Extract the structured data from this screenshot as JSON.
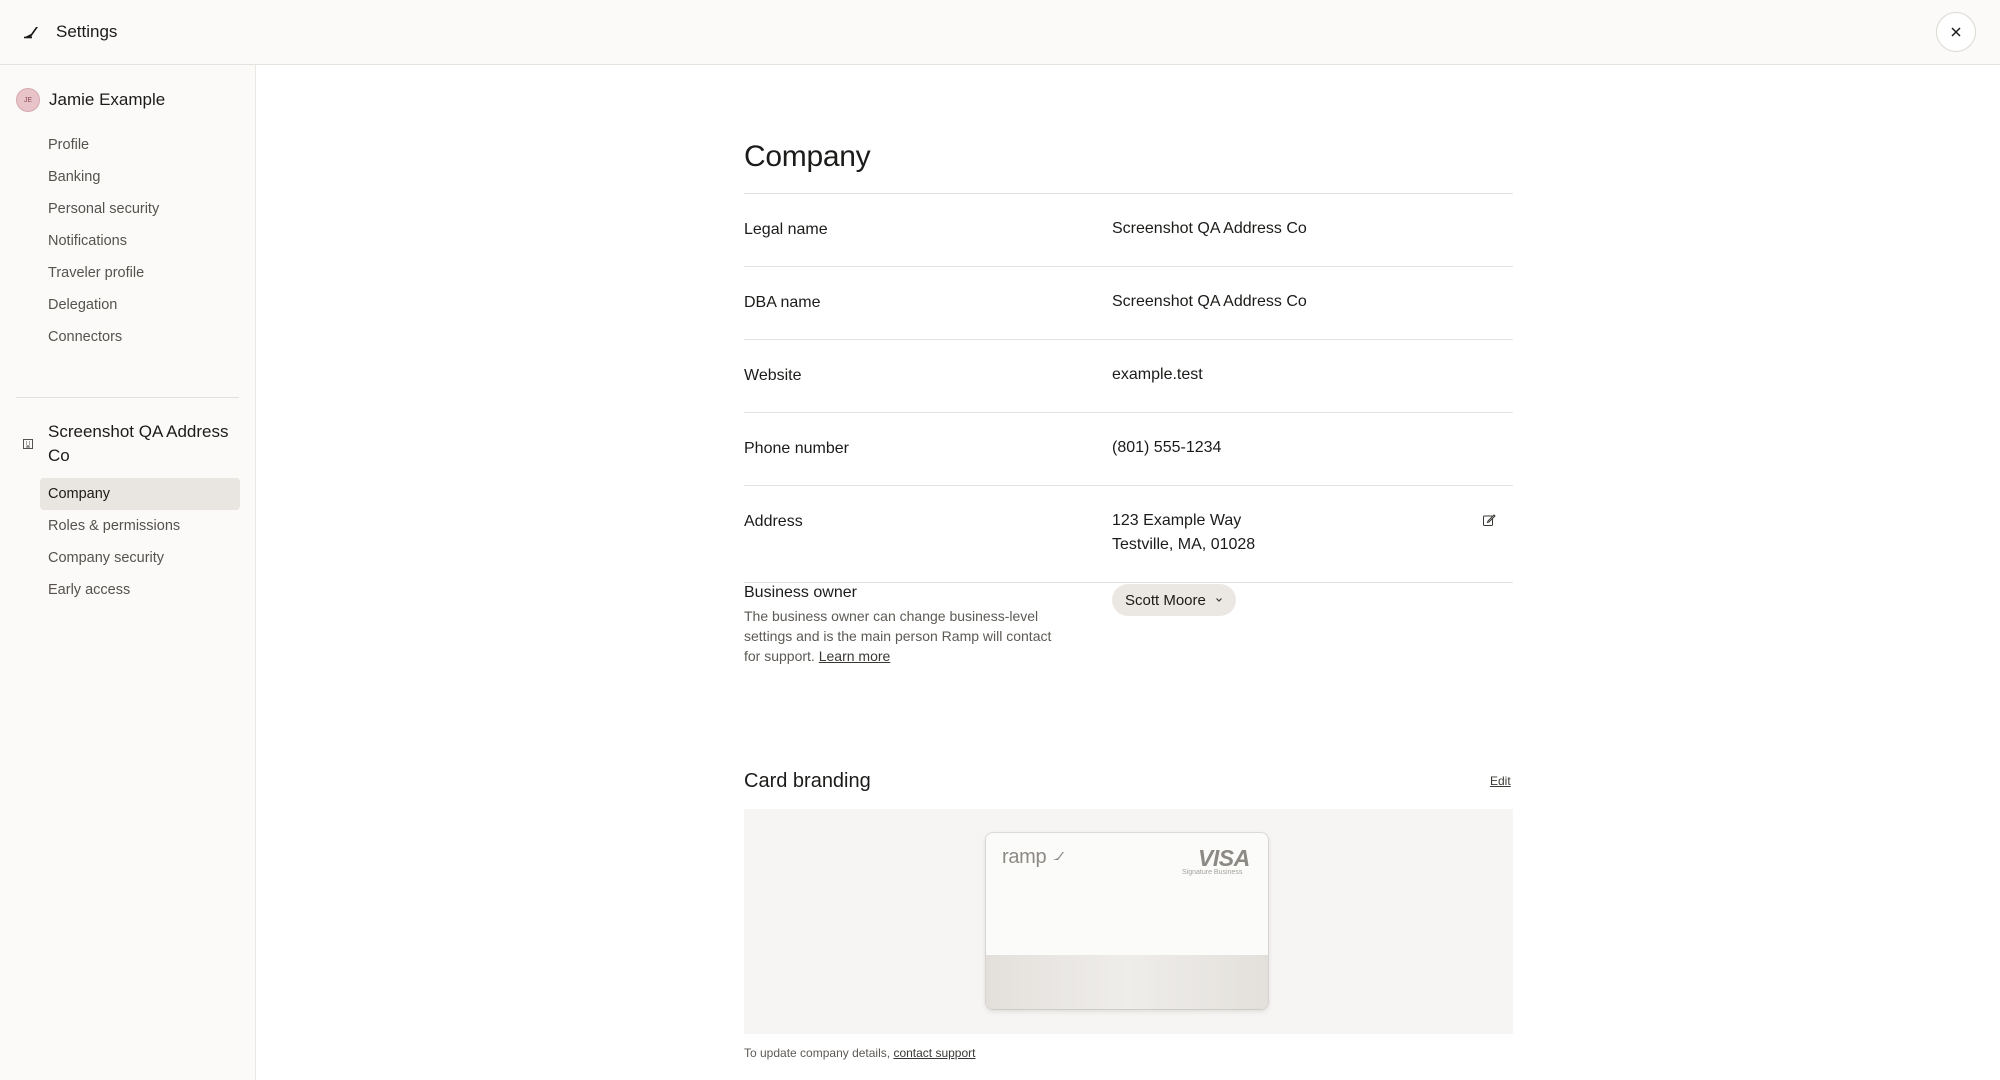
{
  "header": {
    "title": "Settings"
  },
  "sidebar": {
    "user": {
      "initials": "JE",
      "name": "Jamie Example"
    },
    "personal_items": [
      {
        "label": "Profile"
      },
      {
        "label": "Banking"
      },
      {
        "label": "Personal security"
      },
      {
        "label": "Notifications"
      },
      {
        "label": "Traveler profile"
      },
      {
        "label": "Delegation"
      },
      {
        "label": "Connectors"
      }
    ],
    "company": {
      "name": "Screenshot QA Address Co"
    },
    "company_items": [
      {
        "label": "Company",
        "active": true
      },
      {
        "label": "Roles & permissions"
      },
      {
        "label": "Company security"
      },
      {
        "label": "Early access"
      }
    ]
  },
  "main": {
    "title": "Company",
    "fields": {
      "legal_name": {
        "label": "Legal name",
        "value": "Screenshot QA Address Co"
      },
      "dba_name": {
        "label": "DBA name",
        "value": "Screenshot QA Address Co"
      },
      "website": {
        "label": "Website",
        "value": "example.test"
      },
      "phone": {
        "label": "Phone number",
        "value": "(801) 555-1234"
      },
      "address": {
        "label": "Address",
        "line1": "123 Example Way",
        "line2": "Testville, MA, 01028"
      }
    },
    "business_owner": {
      "label": "Business owner",
      "description": "The business owner can change business-level settings and is the main person Ramp will contact for support.",
      "learn_more": "Learn more",
      "selected": "Scott Moore"
    },
    "card_branding": {
      "title": "Card branding",
      "edit": "Edit",
      "card_brand": "ramp",
      "network": "VISA",
      "network_tier": "Signature Business"
    },
    "footnote": {
      "text": "To update company details,",
      "link": "contact support"
    }
  },
  "colors": {
    "active_bg": "#e9e6e2",
    "avatar_bg": "#e8c3c8",
    "chip_bg": "#ebe8e4"
  }
}
